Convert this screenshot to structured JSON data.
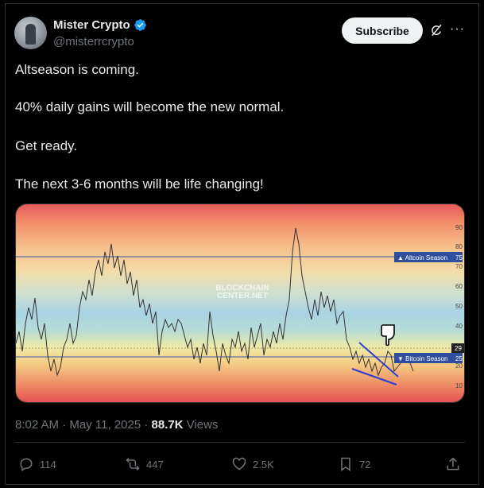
{
  "author": {
    "name": "Mister Crypto",
    "handle": "@misterrcrypto",
    "avatar_icon": "avatar-photo",
    "verified_icon": "verified-badge-icon",
    "verified_color": "#1d9bf0"
  },
  "header": {
    "subscribe_label": "Subscribe",
    "grok_icon": "grok-icon",
    "more_icon": "more-icon"
  },
  "post": {
    "lines": [
      "Altseason is coming.",
      "40% daily gains will become the new normal.",
      "Get ready.",
      "The next 3-6 months will be life changing!"
    ]
  },
  "media": {
    "watermark": [
      "BLOCKCHAIN",
      "CENTER.NET"
    ],
    "axis_ticks": [
      "90",
      "80",
      "70",
      "60",
      "50",
      "40",
      "20",
      "10"
    ],
    "current_value": "29",
    "altcoin_label": "▲ Altcoin Season",
    "altcoin_value": "75",
    "bitcoin_label": "▼ Bitcoin Season",
    "bitcoin_value": "25",
    "pointer_icon": "hand-pointing-down-icon"
  },
  "meta": {
    "time": "8:02 AM",
    "separator": "·",
    "date": "May 11, 2025",
    "views_count": "88.7K",
    "views_label": "Views"
  },
  "actions": {
    "replies": "114",
    "reposts": "447",
    "likes": "2.5K",
    "bookmarks": "72"
  },
  "colors": {
    "background": "#000000",
    "text": "#e7e9ea",
    "muted": "#71767b",
    "border": "#2f3336"
  }
}
